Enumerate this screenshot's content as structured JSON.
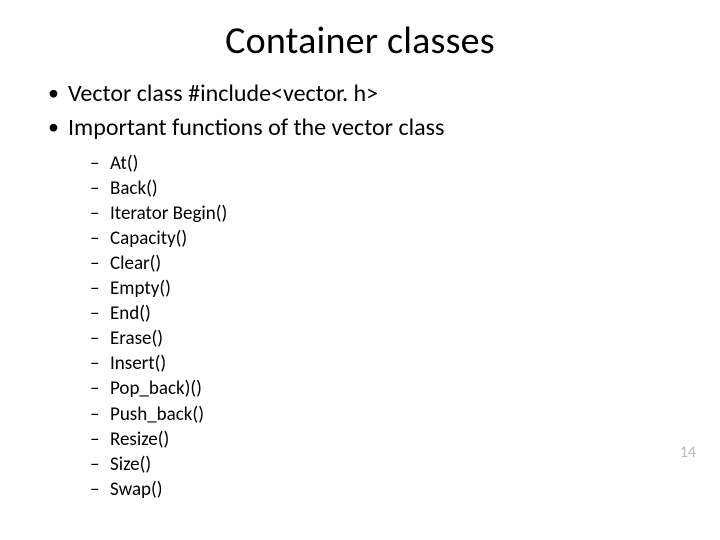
{
  "title": "Container classes",
  "bullets": [
    "Vector class #include<vector. h>",
    "Important functions of the vector class"
  ],
  "functions": [
    "At()",
    "Back()",
    "Iterator Begin()",
    "Capacity()",
    "Clear()",
    "Empty()",
    "End()",
    "Erase()",
    "Insert()",
    "Pop_back)()",
    "Push_back()",
    "Resize()",
    "Size()",
    "Swap()"
  ],
  "page_number": "14"
}
